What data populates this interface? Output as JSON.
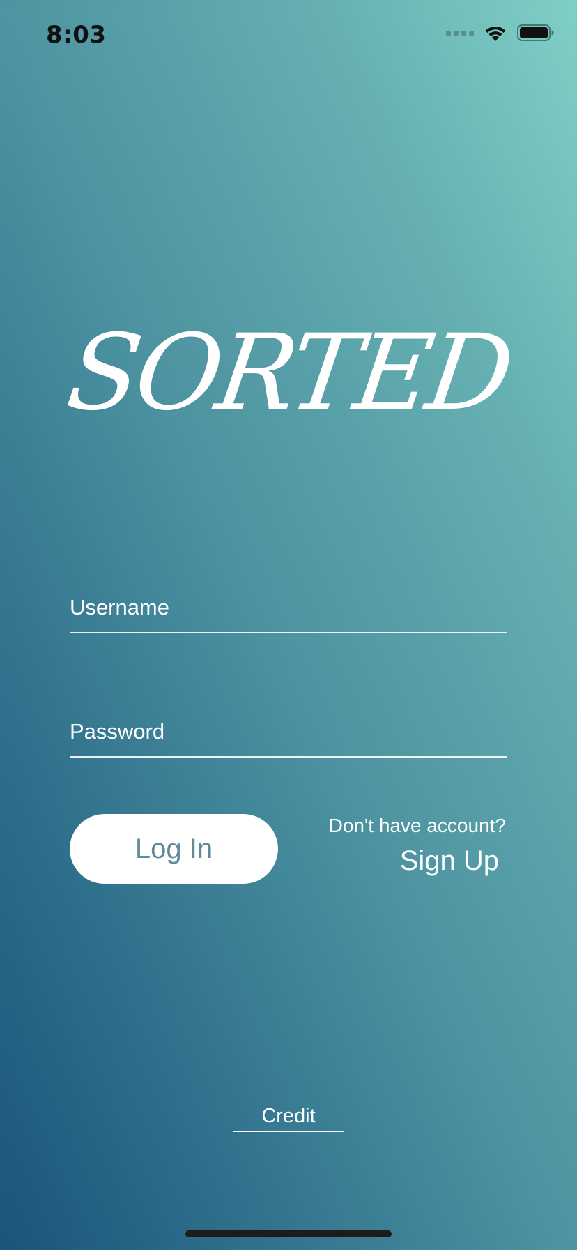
{
  "status_bar": {
    "time": "8:03"
  },
  "app": {
    "logo_text": "SORTED"
  },
  "login_form": {
    "username_placeholder": "Username",
    "password_placeholder": "Password",
    "login_label": "Log In",
    "signup_prompt": "Don't have account?",
    "signup_label": "Sign Up"
  },
  "footer": {
    "credit_label": "Credit"
  },
  "colors": {
    "gradient_top": "#7fd0c6",
    "gradient_bottom": "#1b5479",
    "login_text": "#5f8a9b"
  },
  "icons": {
    "signal": "signal-dots-icon",
    "wifi": "wifi-icon",
    "battery": "battery-icon"
  }
}
